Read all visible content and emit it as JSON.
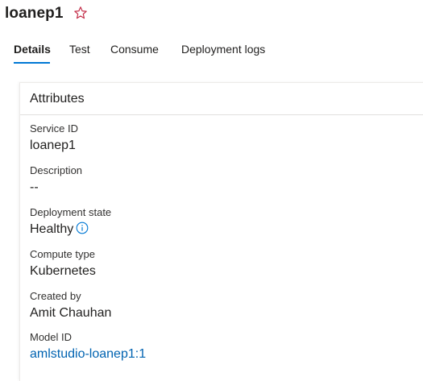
{
  "header": {
    "title": "loanep1",
    "favorite_icon": "star-outline-icon"
  },
  "tabs": [
    {
      "label": "Details",
      "active": true
    },
    {
      "label": "Test",
      "active": false
    },
    {
      "label": "Consume",
      "active": false
    },
    {
      "label": "Deployment logs",
      "active": false
    }
  ],
  "attributes": {
    "heading": "Attributes",
    "service_id": {
      "label": "Service ID",
      "value": "loanep1"
    },
    "description": {
      "label": "Description",
      "value": "--"
    },
    "deployment_state": {
      "label": "Deployment state",
      "value": "Healthy",
      "icon": "info-icon"
    },
    "compute_type": {
      "label": "Compute type",
      "value": "Kubernetes"
    },
    "created_by": {
      "label": "Created by",
      "value": "Amit Chauhan"
    },
    "model_id": {
      "label": "Model ID",
      "value": "amlstudio-loanep1:1"
    }
  },
  "colors": {
    "accent": "#0078d4",
    "link": "#0063b1",
    "star": "#c4314b"
  }
}
